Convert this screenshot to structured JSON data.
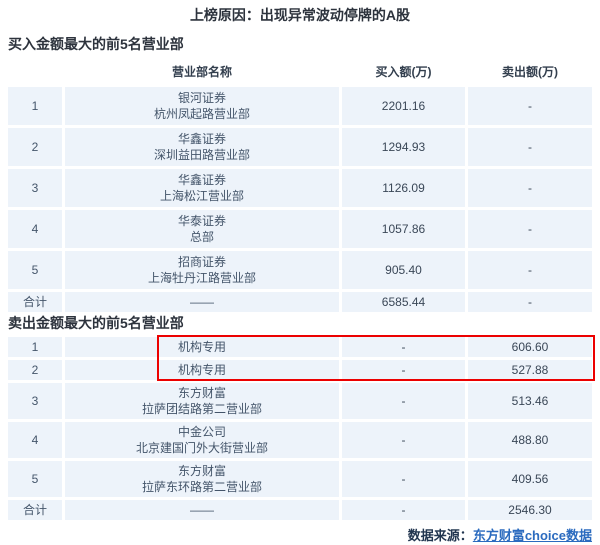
{
  "page": {
    "title": "上榜原因：出现异常波动停牌的A股",
    "footer": {
      "source_label": "数据来源：",
      "source_link_text": "东方财富choice数据"
    }
  },
  "colors": {
    "row_bg": "#edf3fa",
    "title_text": "#2d333d",
    "cell_text": "#44556a",
    "link_blue": "#2b6bbf",
    "highlight_red": "#ec0000"
  },
  "buy_table": {
    "section_title": "买入金额最大的前5名营业部",
    "headers": {
      "name": "营业部名称",
      "buy": "买入额(万)",
      "sell": "卖出额(万)"
    },
    "rows": [
      {
        "rank": "1",
        "broker": "银河证券",
        "branch": "杭州凤起路营业部",
        "buy": "2201.16",
        "sell": "-"
      },
      {
        "rank": "2",
        "broker": "华鑫证券",
        "branch": "深圳益田路营业部",
        "buy": "1294.93",
        "sell": "-"
      },
      {
        "rank": "3",
        "broker": "华鑫证券",
        "branch": "上海松江营业部",
        "buy": "1126.09",
        "sell": "-"
      },
      {
        "rank": "4",
        "broker": "华泰证券",
        "branch": "总部",
        "buy": "1057.86",
        "sell": "-"
      },
      {
        "rank": "5",
        "broker": "招商证券",
        "branch": "上海牡丹江路营业部",
        "buy": "905.40",
        "sell": "-"
      }
    ],
    "total": {
      "label": "合计",
      "name": "——",
      "buy": "6585.44",
      "sell": "-"
    }
  },
  "sell_table": {
    "section_title": "卖出金额最大的前5名营业部",
    "rows": [
      {
        "rank": "1",
        "broker": "机构专用",
        "branch": "",
        "buy": "-",
        "sell": "606.60"
      },
      {
        "rank": "2",
        "broker": "机构专用",
        "branch": "",
        "buy": "-",
        "sell": "527.88"
      },
      {
        "rank": "3",
        "broker": "东方财富",
        "branch": "拉萨团结路第二营业部",
        "buy": "-",
        "sell": "513.46"
      },
      {
        "rank": "4",
        "broker": "中金公司",
        "branch": "北京建国门外大街营业部",
        "buy": "-",
        "sell": "488.80"
      },
      {
        "rank": "5",
        "broker": "东方财富",
        "branch": "拉萨东环路第二营业部",
        "buy": "-",
        "sell": "409.56"
      }
    ],
    "total": {
      "label": "合计",
      "name": "——",
      "buy": "-",
      "sell": "2546.30"
    }
  }
}
